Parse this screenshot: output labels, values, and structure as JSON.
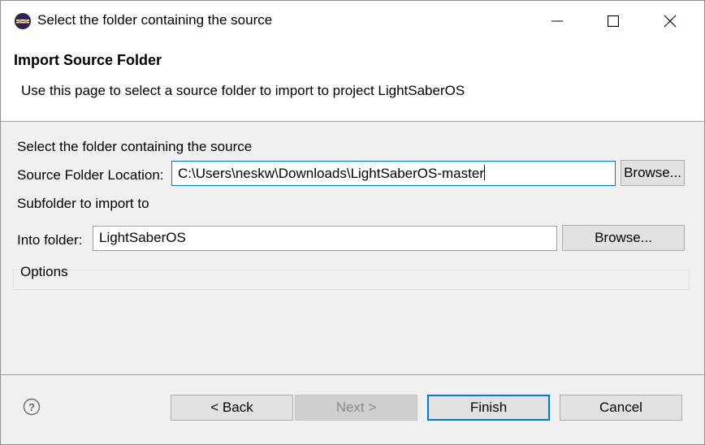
{
  "window": {
    "title": "Select the folder containing the source",
    "icons": {
      "app": "eclipse-icon",
      "minimize": "minimize-icon",
      "maximize": "maximize-icon",
      "close": "close-icon"
    }
  },
  "banner": {
    "title": "Import Source Folder",
    "description": "Use this page to select a source folder to import to project LightSaberOS"
  },
  "form": {
    "intro": "Select the folder containing the source",
    "source_label": "Source Folder Location:",
    "source_value": "C:\\Users\\neskw\\Downloads\\LightSaberOS-master",
    "source_browse": "Browse...",
    "subfolder_label": "Subfolder to import to",
    "into_label": "Into folder:",
    "into_value": "LightSaberOS",
    "into_browse": "Browse...",
    "options_label": "Options"
  },
  "footer": {
    "help_icon": "help-icon",
    "back": "< Back",
    "next": "Next >",
    "finish": "Finish",
    "cancel": "Cancel"
  },
  "colors": {
    "accent": "#0078d7",
    "panel": "#f0f0f0",
    "button": "#e1e1e1"
  }
}
